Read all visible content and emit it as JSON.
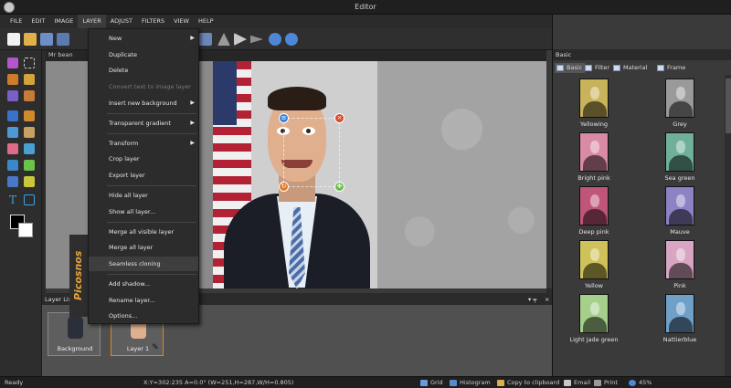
{
  "window": {
    "title": "Editor"
  },
  "menubar": [
    {
      "label": "FILE"
    },
    {
      "label": "EDIT"
    },
    {
      "label": "IMAGE"
    },
    {
      "label": "LAYER"
    },
    {
      "label": "ADJUST"
    },
    {
      "label": "FILTERS"
    },
    {
      "label": "VIEW"
    },
    {
      "label": "HELP"
    }
  ],
  "document": {
    "tab_label": "Mr bean"
  },
  "layer_menu": [
    {
      "label": "New",
      "submenu": true
    },
    {
      "label": "Duplicate"
    },
    {
      "label": "Delete"
    },
    {
      "label": "Convert text to image layer",
      "disabled": true
    },
    {
      "label": "Insert new background",
      "submenu": true
    },
    {
      "label": "Transparent gradient",
      "submenu": true
    },
    {
      "label": "Transform",
      "submenu": true
    },
    {
      "label": "Crop layer"
    },
    {
      "label": "Export layer"
    },
    {
      "label": "Hide all layer"
    },
    {
      "label": "Show all layer..."
    },
    {
      "label": "Merge all visible layer"
    },
    {
      "label": "Merge all layer"
    },
    {
      "label": "Seamless cloning",
      "highlight": true
    },
    {
      "label": "Add shadow..."
    },
    {
      "label": "Rename layer..."
    },
    {
      "label": "Options..."
    }
  ],
  "layer_panel": {
    "title": "Layer List",
    "controls": {
      "pin": "▾ ╤",
      "close": "×"
    },
    "layers": [
      {
        "label": "Background"
      },
      {
        "label": "Layer 1"
      }
    ]
  },
  "watermark": "Picosnos",
  "right_panel": {
    "title": "Basic",
    "tabs": [
      {
        "label": "Basic"
      },
      {
        "label": "Filter"
      },
      {
        "label": "Material"
      },
      {
        "label": "Frame"
      }
    ],
    "filters": [
      {
        "label": "Yellowing",
        "tint": "#c8b25a"
      },
      {
        "label": "Grey",
        "tint": "#9a9a9a"
      },
      {
        "label": "Bright pink",
        "tint": "#d98aa5"
      },
      {
        "label": "Sea green",
        "tint": "#6fb09a"
      },
      {
        "label": "Deep pink",
        "tint": "#c0557a"
      },
      {
        "label": "Mauve",
        "tint": "#8c82c4"
      },
      {
        "label": "Yellow",
        "tint": "#cfc25a"
      },
      {
        "label": "Pink",
        "tint": "#d8a6c2"
      },
      {
        "label": "Light jade green",
        "tint": "#a6cf8c"
      },
      {
        "label": "Nattierblue",
        "tint": "#6fa0c8"
      }
    ]
  },
  "statusbar": {
    "status": "Ready",
    "coords": "X:Y=302:235  A=0.0° (W=251,H=287,W/H=0.805)",
    "grid": "Grid",
    "histogram": "Histogram",
    "copy": "Copy to clipboard",
    "email": "Email",
    "print": "Print",
    "zoom": "45%"
  },
  "colors": {
    "accent": "#e7a33a",
    "menu_bg": "#2c2c2c",
    "panel_bg": "#3a3a3a"
  }
}
